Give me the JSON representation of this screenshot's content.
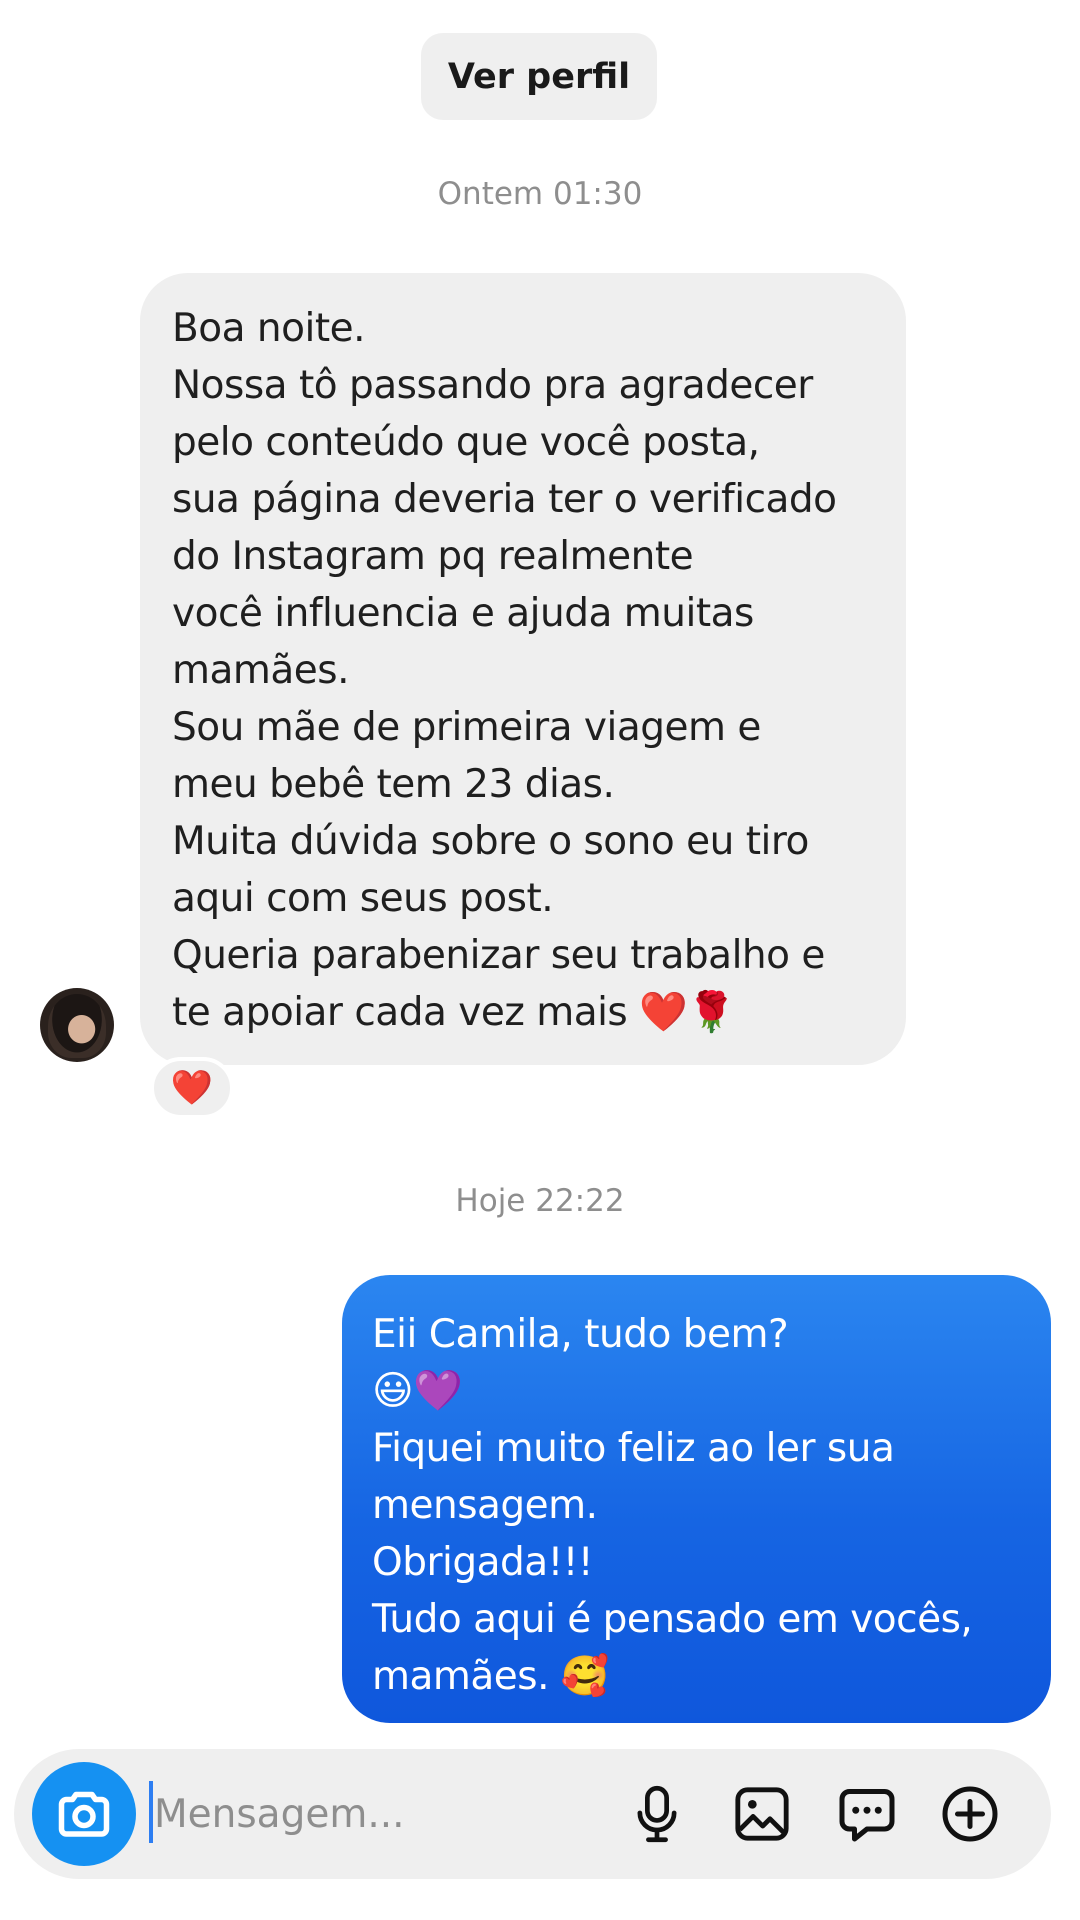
{
  "header": {
    "view_profile_label": "Ver perfil"
  },
  "timestamps": {
    "first": "Ontem 01:30",
    "second": "Hoje 22:22"
  },
  "incoming_message": {
    "lines": [
      "Boa noite.",
      "Nossa tô passando pra agradecer",
      "pelo conteúdo que você posta,",
      "sua página deveria ter o verificado",
      "do Instagram pq realmente",
      "você influencia e ajuda muitas",
      "mamães.",
      "Sou mãe de primeira viagem e",
      "meu bebê tem 23 dias.",
      "Muita dúvida sobre o sono eu tiro",
      "aqui com seus post.",
      "Queria parabenizar seu trabalho e",
      "te apoiar cada vez mais ❤️🌹"
    ],
    "reaction": "❤️"
  },
  "outgoing_message": {
    "lines": [
      "Eii Camila, tudo bem?",
      "😃💜",
      "Fiquei muito feliz ao ler sua",
      "mensagem.",
      "Obrigada!!!",
      "Tudo aqui é pensado em vocês,",
      "mamães. 🥰"
    ]
  },
  "composer": {
    "placeholder": "Mensagem...",
    "icons": [
      "camera-icon",
      "microphone-icon",
      "gallery-icon",
      "sticker-icon",
      "plus-icon"
    ]
  },
  "colors": {
    "outgoing_bubble": "#1a6fe8",
    "incoming_bubble": "#efefef",
    "camera_button": "#1591f2",
    "reaction_heart": "#e4182c"
  }
}
